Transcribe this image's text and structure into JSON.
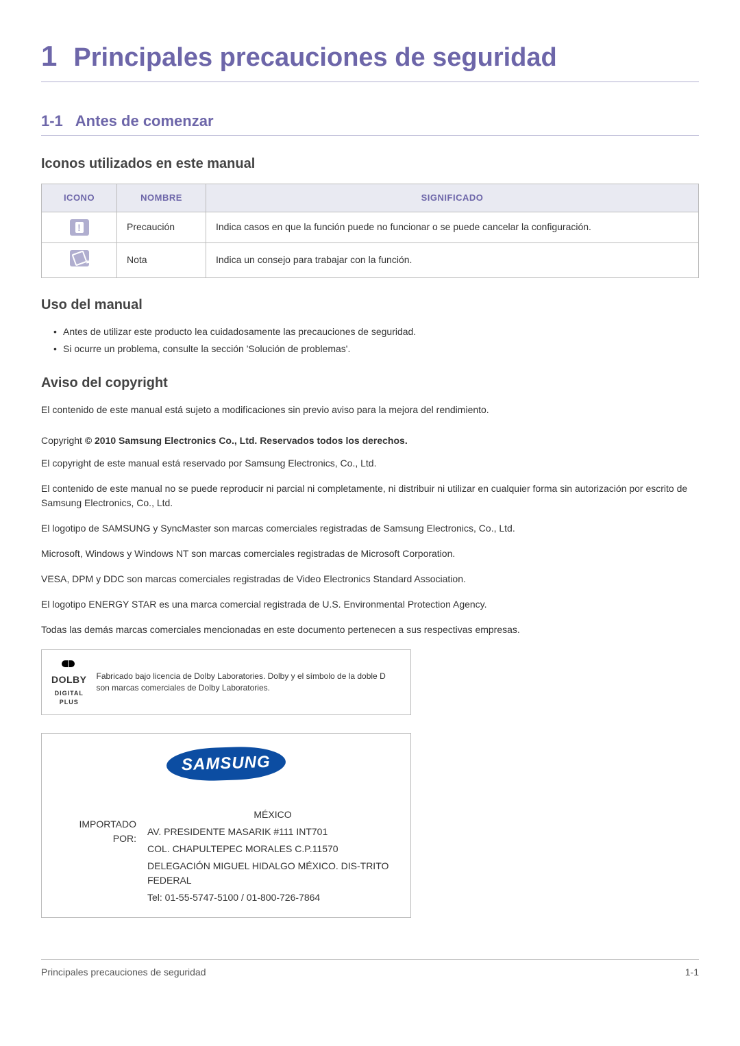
{
  "chapter": {
    "num": "1",
    "title": "Principales precauciones de seguridad"
  },
  "section": {
    "num": "1-1",
    "title": "Antes de comenzar"
  },
  "icons_table": {
    "heading": "Iconos utilizados en este manual",
    "headers": {
      "icon": "ICONO",
      "name": "NOMBRE",
      "meaning": "SIGNIFICADO"
    },
    "rows": [
      {
        "icon_name": "caution-icon",
        "name": "Precaución",
        "meaning": "Indica casos en que la función puede no funcionar o se puede cancelar la configuración."
      },
      {
        "icon_name": "note-icon",
        "name": "Nota",
        "meaning": "Indica un consejo para trabajar con la función."
      }
    ]
  },
  "manual_use": {
    "heading": "Uso del manual",
    "bullets": [
      "Antes de utilizar este producto lea cuidadosamente las precauciones de seguridad.",
      "Si ocurre un problema, consulte la sección 'Solución de problemas'."
    ]
  },
  "copyright": {
    "heading": "Aviso del copyright",
    "intro": "El contenido de este manual está sujeto a modificaciones sin previo aviso para la mejora del rendimiento.",
    "line_prefix": "Copyright ",
    "line_bold": "© 2010 Samsung Electronics Co., Ltd. Reservados todos los derechos.",
    "paras": [
      "El copyright de este manual está reservado por Samsung Electronics, Co., Ltd.",
      "El contenido de este manual no se puede reproducir ni parcial ni completamente, ni distribuir ni utilizar en cualquier forma sin autorización por escrito de Samsung Electronics, Co., Ltd.",
      "El logotipo de SAMSUNG y SyncMaster son marcas comerciales registradas de Samsung Electronics, Co., Ltd.",
      "Microsoft, Windows y Windows NT son marcas comerciales registradas de Microsoft Corporation.",
      "VESA, DPM y DDC son marcas comerciales registradas de Video Electronics Standard Association.",
      "El logotipo ENERGY STAR es una marca comercial registrada de U.S. Environmental Protection Agency.",
      "Todas las demás marcas comerciales mencionadas en este documento pertenecen a sus respectivas empresas."
    ]
  },
  "dolby": {
    "logo_top": "DOLBY",
    "logo_sub": "DIGITAL PLUS",
    "text": "Fabricado bajo licencia de Dolby Laboratories. Dolby y el símbolo de la doble D son marcas comerciales de Dolby Laboratories."
  },
  "importer": {
    "logo_text": "SAMSUNG",
    "label": "IMPORTADO POR:",
    "lines": [
      "MÉXICO",
      "AV. PRESIDENTE MASARIK #111 INT701",
      "COL. CHAPULTEPEC MORALES C.P.11570",
      "DELEGACIÓN MIGUEL HIDALGO MÉXICO. DIS-TRITO FEDERAL",
      "Tel: 01-55-5747-5100 / 01-800-726-7864"
    ]
  },
  "footer": {
    "left": "Principales precauciones de seguridad",
    "right": "1-1"
  }
}
